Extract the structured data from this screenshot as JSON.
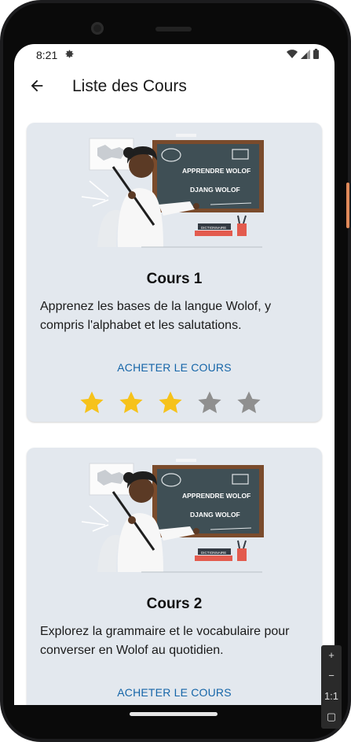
{
  "status": {
    "time": "8:21"
  },
  "appbar": {
    "title": "Liste des Cours"
  },
  "board": {
    "line1": "APPRENDRE WOLOF",
    "line2": "DJANG WOLOF",
    "book": "DICTIONNAIRE"
  },
  "courses": [
    {
      "title": "Cours 1",
      "description": "Apprenez les bases de la langue Wolof, y compris l'alphabet et les salutations.",
      "buy_label": "ACHETER LE COURS",
      "rating": 3,
      "max_rating": 5
    },
    {
      "title": "Cours 2",
      "description": "Explorez la grammaire et le vocabulaire pour converser en Wolof au quotidien.",
      "buy_label": "ACHETER LE COURS"
    }
  ],
  "colors": {
    "star_filled": "#f6c21a",
    "star_empty": "#8f8f8f",
    "link": "#1565a8",
    "card": "#e3e8ee"
  },
  "emulator": {
    "zoom_in": "+",
    "zoom_out": "−",
    "zoom_reset": "1:1"
  }
}
